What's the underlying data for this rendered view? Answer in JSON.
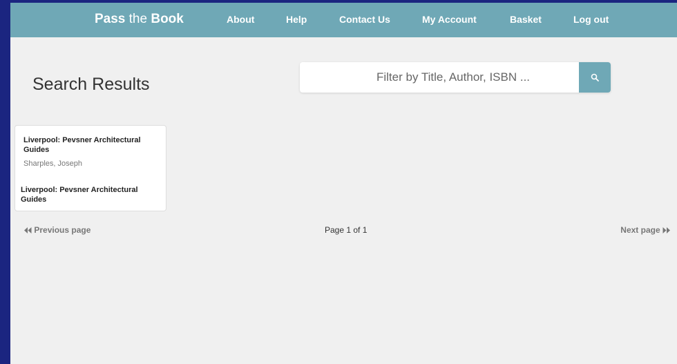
{
  "nav": {
    "brand_strong1": "Pass",
    "brand_mid": "the",
    "brand_strong2": "Book",
    "links": [
      "About",
      "Help",
      "Contact Us",
      "My Account",
      "Basket",
      "Log out"
    ]
  },
  "page": {
    "title": "Search Results"
  },
  "search": {
    "placeholder": "Filter by Title, Author, ISBN ...",
    "value": "",
    "button_icon": "search-icon"
  },
  "results": [
    {
      "title": "Liverpool: Pevsner Architectural Guides",
      "author": "Sharples, Joseph",
      "subtitle": "Liverpool: Pevsner Architectural Guides"
    }
  ],
  "pagination": {
    "prev_label": "Previous page",
    "info": "Page 1 of 1",
    "next_label": "Next page",
    "prev_icon": "double-chevron-left-icon",
    "next_icon": "double-chevron-right-icon"
  },
  "colors": {
    "navbar": "#6fa8b6",
    "background": "#f0f0f0",
    "outer_frame": "#1b2580"
  }
}
